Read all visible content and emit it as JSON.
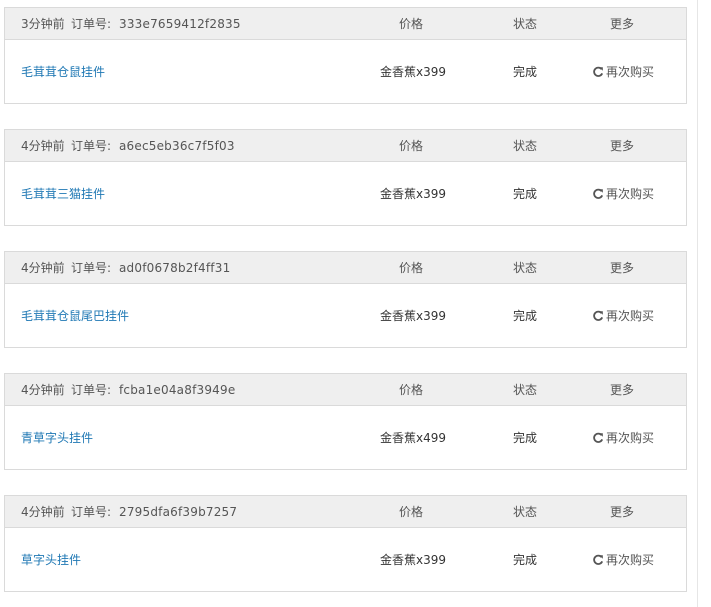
{
  "labels": {
    "order_no": "订单号:",
    "price": "价格",
    "status": "状态",
    "more": "更多",
    "rebuy": "再次购买"
  },
  "icons": {
    "rebuy": "refresh-icon"
  },
  "colors": {
    "link": "#1f78b4",
    "header_bg": "#efefef",
    "border": "#dadada"
  },
  "orders": [
    {
      "time": "3分钟前",
      "order_no": "333e7659412f2835",
      "item": "毛茸茸仓鼠挂件",
      "price": "金香蕉x399",
      "status": "完成"
    },
    {
      "time": "4分钟前",
      "order_no": "a6ec5eb36c7f5f03",
      "item": "毛茸茸三猫挂件",
      "price": "金香蕉x399",
      "status": "完成"
    },
    {
      "time": "4分钟前",
      "order_no": "ad0f0678b2f4ff31",
      "item": "毛茸茸仓鼠尾巴挂件",
      "price": "金香蕉x399",
      "status": "完成"
    },
    {
      "time": "4分钟前",
      "order_no": "fcba1e04a8f3949e",
      "item": "青草字头挂件",
      "price": "金香蕉x499",
      "status": "完成"
    },
    {
      "time": "4分钟前",
      "order_no": "2795dfa6f39b7257",
      "item": "草字头挂件",
      "price": "金香蕉x399",
      "status": "完成"
    }
  ]
}
